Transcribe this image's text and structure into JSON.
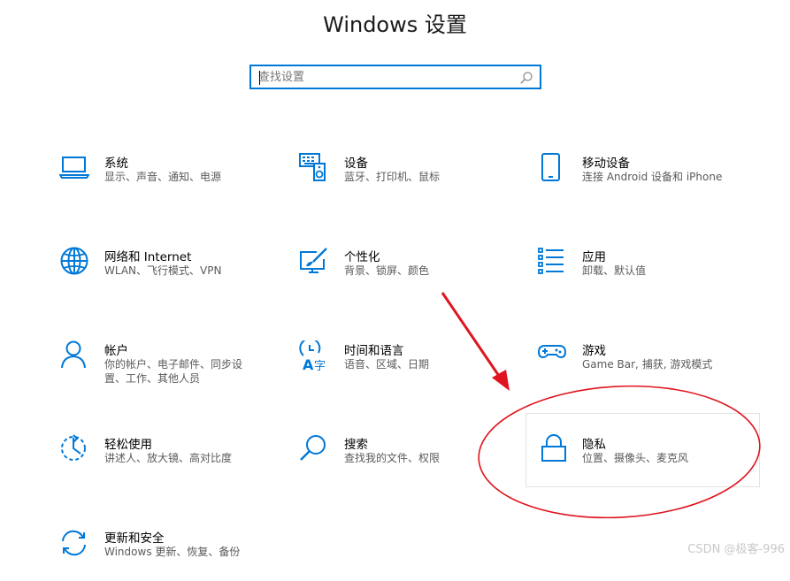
{
  "window": {
    "title": "Windows 设置"
  },
  "search": {
    "placeholder": "查找设置"
  },
  "tiles": [
    {
      "name": "系统",
      "desc": "显示、声音、通知、电源",
      "icon": "laptop-icon"
    },
    {
      "name": "设备",
      "desc": "蓝牙、打印机、鼠标",
      "icon": "keyboard-speaker-icon"
    },
    {
      "name": "移动设备",
      "desc": "连接 Android 设备和 iPhone",
      "icon": "phone-icon"
    },
    {
      "name": "网络和 Internet",
      "desc": "WLAN、飞行模式、VPN",
      "icon": "globe-icon"
    },
    {
      "name": "个性化",
      "desc": "背景、锁屏、颜色",
      "icon": "paint-brush-icon"
    },
    {
      "name": "应用",
      "desc": "卸载、默认值",
      "icon": "app-list-icon"
    },
    {
      "name": "帐户",
      "desc": "你的帐户、电子邮件、同步设置、工作、其他人员",
      "icon": "person-icon"
    },
    {
      "name": "时间和语言",
      "desc": "语音、区域、日期",
      "icon": "time-language-icon"
    },
    {
      "name": "游戏",
      "desc": "Game Bar, 捕获, 游戏模式",
      "icon": "gamepad-icon"
    },
    {
      "name": "轻松使用",
      "desc": "讲述人、放大镜、高对比度",
      "icon": "ease-of-access-icon"
    },
    {
      "name": "搜索",
      "desc": "查找我的文件、权限",
      "icon": "magnifier-icon"
    },
    {
      "name": "隐私",
      "desc": "位置、摄像头、麦克风",
      "icon": "lock-icon"
    },
    {
      "name": "更新和安全",
      "desc": "Windows 更新、恢复、备份",
      "icon": "sync-icon"
    }
  ],
  "colors": {
    "accent": "#0078d7",
    "annotation": "#e0141e"
  },
  "watermark": "CSDN @极客-996"
}
